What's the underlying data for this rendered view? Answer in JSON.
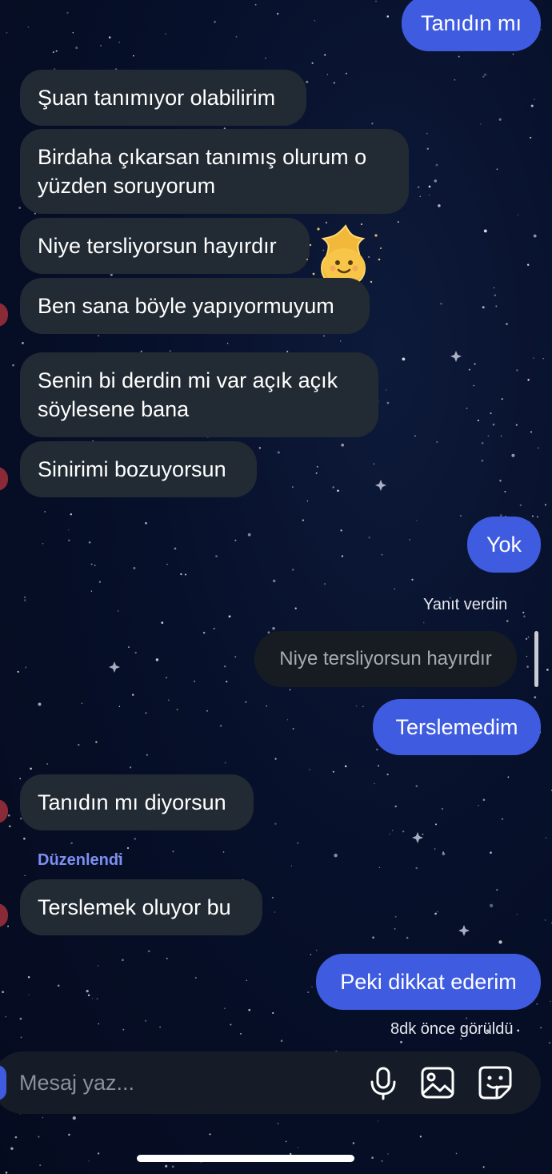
{
  "messages": {
    "m1_out": "Tanıdın mı",
    "m2_in": "Şuan tanımıyor olabilirim",
    "m3_in_line1": "Birdaha çıkarsan tanımış olurum o",
    "m3_in_line2": "yüzden soruyorum",
    "m4_in": "Niye tersliyorsun hayırdır",
    "m5_in": "Ben sana böyle yapıyormuyum",
    "m6_in_line1": "Senin bi derdin mi var açık açık",
    "m6_in_line2": "söylesene bana",
    "m7_in": "Sinirimi bozuyorsun",
    "m8_out": "Yok",
    "m9_reply_label": "Yanıt verdin",
    "m9_reply_quote": "Niye tersliyorsun hayırdır",
    "m9_out": "Terslemedim",
    "m10_in": "Tanıdın mı diyorsun",
    "m11_edited_label": "Düzenlendi",
    "m11_in": "Terslemek oluyor bu",
    "m12_out": "Peki dikkat ederim",
    "seen_status": "8dk önce görüldü"
  },
  "sticker": "sparkle-star-sticker",
  "composer": {
    "placeholder": "Mesaj yaz...",
    "icons": [
      "microphone-icon",
      "image-gallery-icon",
      "sticker-icon"
    ]
  },
  "colors": {
    "background": "#07102a",
    "incoming_bubble": "#222a33",
    "outgoing_bubble": "#3f5ce0",
    "reply_quote_bubble": "#171c22",
    "edited_label": "#7d8ff0",
    "composer": "#151c27"
  }
}
